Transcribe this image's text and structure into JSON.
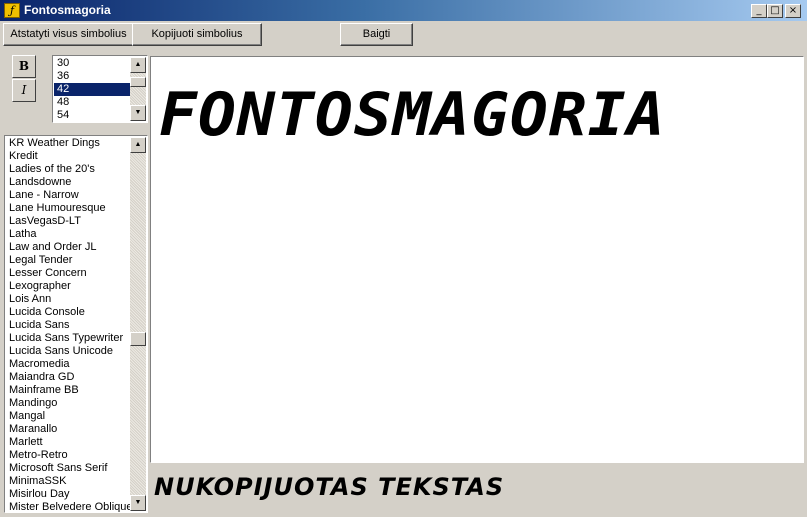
{
  "window": {
    "title": "Fontosmagoria"
  },
  "toolbar": {
    "reset_label": "Atstatyti visus simbolius",
    "copy_label": "Kopijuoti simbolius",
    "finish_label": "Baigti"
  },
  "style_buttons": {
    "bold": "B",
    "italic": "I"
  },
  "size_list": {
    "items": [
      "30",
      "36",
      "42",
      "48",
      "54"
    ],
    "selected": "42"
  },
  "font_list": {
    "items": [
      "KR Weather Dings",
      "Kredit",
      "Ladies of the 20's",
      "Landsdowne",
      "Lane - Narrow",
      "Lane Humouresque",
      "LasVegasD-LT",
      "Latha",
      "Law and Order JL",
      "Legal Tender",
      "Lesser Concern",
      "Lexographer",
      "Lois Ann",
      "Lucida Console",
      "Lucida Sans",
      "Lucida Sans Typewriter",
      "Lucida Sans Unicode",
      "Macromedia",
      "Maiandra GD",
      "Mainframe BB",
      "Mandingo",
      "Mangal",
      "Maranallo",
      "Marlett",
      "Metro-Retro",
      "Microsoft Sans Serif",
      "MinimaSSK",
      "Misirlou Day",
      "Mister Belvedere Oblique"
    ]
  },
  "preview": {
    "text": "FONTOSMAGORIA"
  },
  "status": {
    "copied_text": "NUKOPIJUOTAS TEKSTAS"
  }
}
